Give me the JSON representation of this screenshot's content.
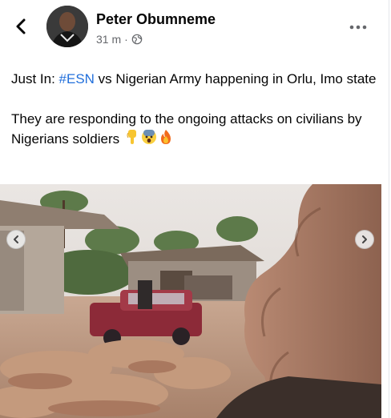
{
  "post": {
    "author": "Peter Obumneme",
    "timestamp": "31 m",
    "separator": "·",
    "privacy_icon": "globe-icon",
    "more_icon": "more-options-icon",
    "back_icon": "chevron-left-icon",
    "text_line1_prefix": "Just In: ",
    "hashtag": "#ESN",
    "text_line1_suffix": " vs Nigerian Army happening in Orlu, Imo state",
    "text_line2": "They are responding to the ongoing attacks on civilians by Nigerians soldiers",
    "emojis": [
      "pointing-down-emoji",
      "fearful-face-emoji",
      "fire-emoji"
    ]
  },
  "media": {
    "prev_icon": "chevron-left-icon",
    "next_icon": "chevron-right-icon"
  },
  "colors": {
    "link": "#216fdb",
    "meta": "#65676b",
    "text": "#050505"
  }
}
